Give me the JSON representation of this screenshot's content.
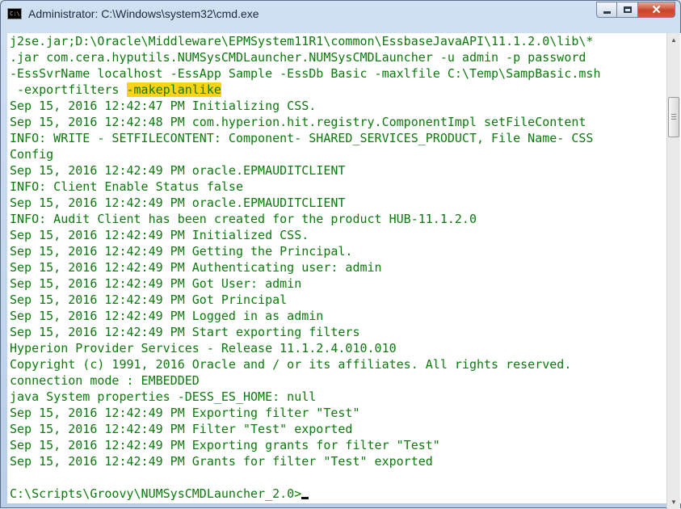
{
  "window": {
    "title": "Administrator: C:\\Windows\\system32\\cmd.exe",
    "icon": "cmd-icon",
    "icon_text": "C:\\."
  },
  "controls": {
    "close_label": "✕"
  },
  "console": {
    "lines": [
      "j2se.jar;D:\\Oracle\\Middleware\\EPMSystem11R1\\common\\EssbaseJavaAPI\\11.1.2.0\\lib\\*",
      ".jar com.cera.hyputils.NUMSysCMDLauncher.NUMSysCMDLauncher -u admin -p password",
      "-EssSvrName localhost -EssApp Sample -EssDb Basic -maxlfile C:\\Temp\\SampBasic.msh",
      {
        "text": " -exportfilters ",
        "highlight": "-makeplanlike"
      },
      "Sep 15, 2016 12:42:47 PM Initializing CSS.",
      "Sep 15, 2016 12:42:48 PM com.hyperion.hit.registry.ComponentImpl setFileContent",
      "INFO: WRITE - SETFILECONTENT: Component- SHARED_SERVICES_PRODUCT, File Name- CSS",
      "Config",
      "Sep 15, 2016 12:42:49 PM oracle.EPMAUDITCLIENT",
      "INFO: Client Enable Status false",
      "Sep 15, 2016 12:42:49 PM oracle.EPMAUDITCLIENT",
      "INFO: Audit Client has been created for the product HUB-11.1.2.0",
      "Sep 15, 2016 12:42:49 PM Initialized CSS.",
      "Sep 15, 2016 12:42:49 PM Getting the Principal.",
      "Sep 15, 2016 12:42:49 PM Authenticating user: admin",
      "Sep 15, 2016 12:42:49 PM Got User: admin",
      "Sep 15, 2016 12:42:49 PM Got Principal",
      "Sep 15, 2016 12:42:49 PM Logged in as admin",
      "Sep 15, 2016 12:42:49 PM Start exporting filters",
      "Hyperion Provider Services - Release 11.1.2.4.010.010",
      "Copyright (c) 1991, 2016 Oracle and / or its affiliates. All rights reserved.",
      "connection mode : EMBEDDED",
      "java System properties -DESS_ES_HOME: null",
      "Sep 15, 2016 12:42:49 PM Exporting filter \"Test\"",
      "Sep 15, 2016 12:42:49 PM Filter \"Test\" exported",
      "Sep 15, 2016 12:42:49 PM Exporting grants for filter \"Test\"",
      "Sep 15, 2016 12:42:49 PM Grants for filter \"Test\" exported",
      ""
    ],
    "prompt": "C:\\Scripts\\Groovy\\NUMSysCMDLauncher_2.0>"
  },
  "colors": {
    "text": "#0c7a0c",
    "background": "#ffffff",
    "highlight": "#ffd21a"
  }
}
